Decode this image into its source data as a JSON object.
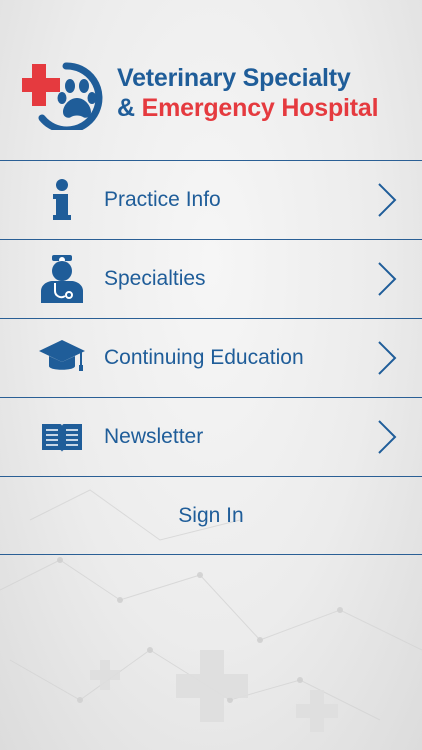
{
  "app": {
    "title_line1": "Veterinary Specialty",
    "title_amp": "&",
    "title_line2": "Emergency Hospital"
  },
  "colors": {
    "brand_blue": "#1f5d99",
    "brand_red": "#e53a3f",
    "divider": "#2a5f95"
  },
  "menu": {
    "items": [
      {
        "label": "Practice Info",
        "icon": "info-icon"
      },
      {
        "label": "Specialties",
        "icon": "doctor-icon"
      },
      {
        "label": "Continuing Education",
        "icon": "graduation-cap-icon"
      },
      {
        "label": "Newsletter",
        "icon": "book-icon"
      }
    ]
  },
  "signin": {
    "label": "Sign In"
  }
}
